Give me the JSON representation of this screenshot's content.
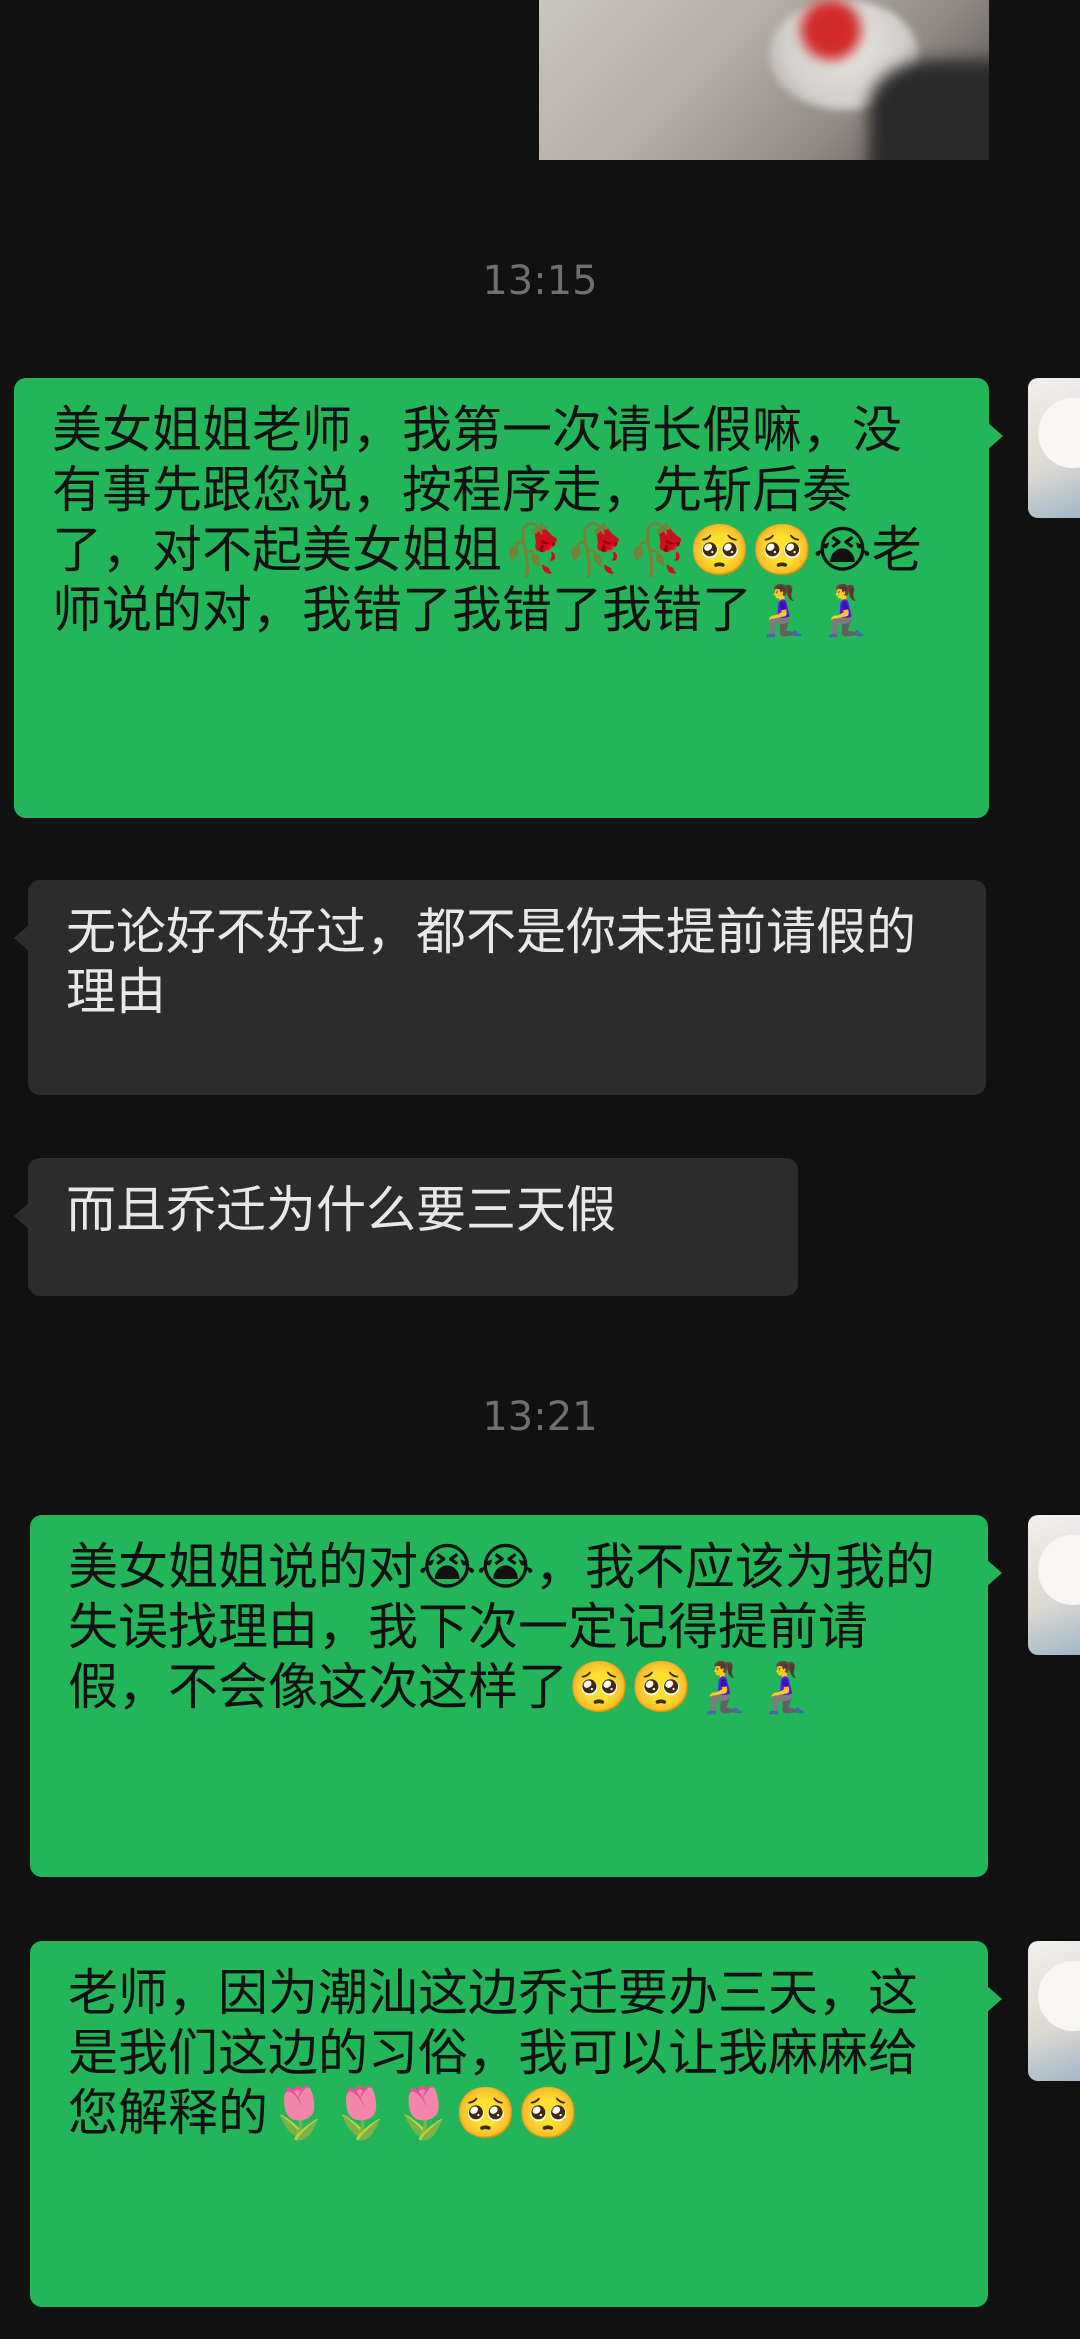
{
  "timestamps": [
    "13:15",
    "13:21"
  ],
  "messages": [
    {
      "direction": "out",
      "text": "美女姐姐老师，我第一次请长假嘛，没有事先跟您说，按程序走，先斩后奏了，对不起美女姐姐🥀🥀🥀🥺🥺😭老师说的对，我错了我错了我错了🧎‍♀️🧎‍♀️"
    },
    {
      "direction": "in",
      "text": "无论好不好过，都不是你未提前请假的理由"
    },
    {
      "direction": "in",
      "text": "而且乔迁为什么要三天假"
    },
    {
      "direction": "out",
      "text": "美女姐姐说的对😭😭，我不应该为我的失误找理由，我下次一定记得提前请假，不会像这次这样了🥺🥺🧎‍♀️🧎‍♀️"
    },
    {
      "direction": "out",
      "text": "老师，因为潮汕这边乔迁要办三天，这是我们这边的习俗，我可以让我麻麻给您解释的🌷🌷🌷🥺🥺"
    }
  ],
  "colors": {
    "background": "#111111",
    "outgoing_bubble": "#22b55a",
    "incoming_bubble": "#2c2c2c",
    "timestamp": "#6f6f6f"
  }
}
